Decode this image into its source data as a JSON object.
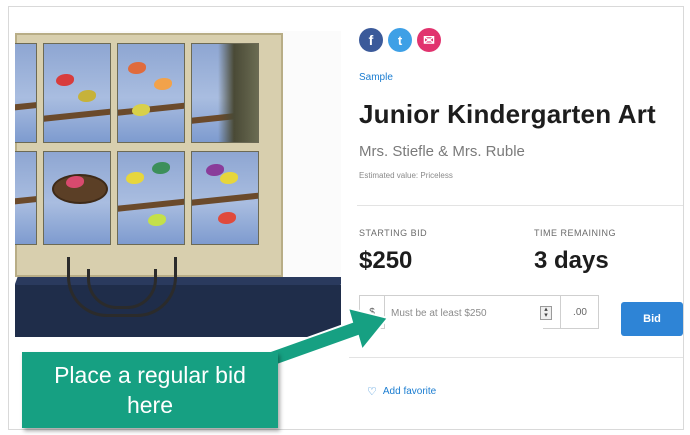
{
  "listing": {
    "tag": "Sample",
    "title": "Junior Kindergarten Art",
    "subtitle": "Mrs. Stiefle & Mrs. Ruble",
    "estimated_value": "Estimated value: Priceless"
  },
  "share": {
    "facebook_glyph": "f",
    "twitter_glyph": "t",
    "email_glyph": "✉",
    "icons": [
      "facebook-icon",
      "twitter-icon",
      "email-icon"
    ]
  },
  "bid_info": {
    "starting_bid_label": "STARTING BID",
    "starting_bid_value": "$250",
    "time_remaining_label": "TIME REMAINING",
    "time_remaining_value": "3 days"
  },
  "bid_form": {
    "currency_symbol": "$",
    "amount_placeholder": "Must be at least $250",
    "cents": ".00",
    "bid_button_label": "Bid"
  },
  "favorite": {
    "label": "Add favorite",
    "icon": "heart-icon"
  },
  "callout": {
    "text": "Place a regular bid here"
  },
  "colors": {
    "accent": "#2e84d6",
    "link": "#1b7dd1",
    "callout": "#16a082",
    "facebook": "#3b5a9a",
    "twitter": "#3ea0e6",
    "email": "#e1336e"
  }
}
